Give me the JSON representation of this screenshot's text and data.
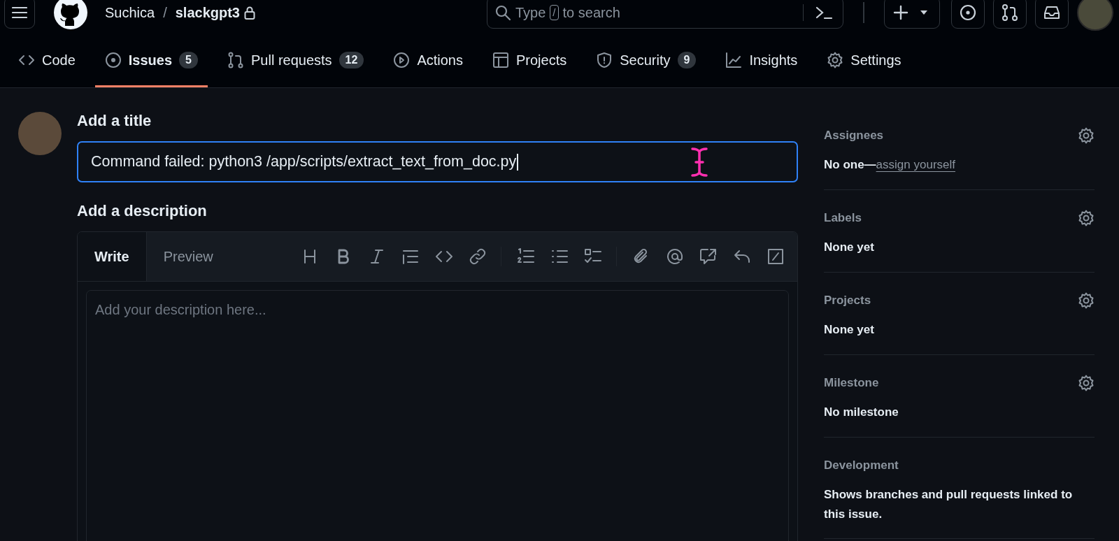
{
  "header": {
    "owner": "Suchica",
    "separator": "/",
    "repo": "slackgpt3",
    "private": true,
    "search": {
      "prefix": "Type",
      "key": "/",
      "suffix": "to search"
    }
  },
  "tabs": [
    {
      "kind": "code",
      "label": "Code",
      "selected": false
    },
    {
      "kind": "issue",
      "label": "Issues",
      "count": "5",
      "selected": true
    },
    {
      "kind": "pr",
      "label": "Pull requests",
      "count": "12",
      "selected": false
    },
    {
      "kind": "play",
      "label": "Actions",
      "selected": false
    },
    {
      "kind": "table",
      "label": "Projects",
      "selected": false
    },
    {
      "kind": "shield",
      "label": "Security",
      "count": "9",
      "selected": false
    },
    {
      "kind": "graph",
      "label": "Insights",
      "selected": false
    },
    {
      "kind": "gear",
      "label": "Settings",
      "selected": false
    }
  ],
  "form": {
    "title_label": "Add a title",
    "title_value": "Command failed: python3 /app/scripts/extract_text_from_doc.py",
    "description_label": "Add a description",
    "editor_tabs": [
      {
        "label": "Write",
        "selected": true
      },
      {
        "label": "Preview",
        "selected": false
      }
    ],
    "description_placeholder": "Add your description here..."
  },
  "sidebar": [
    {
      "heading": "Assignees",
      "gear": true,
      "value": "No one—",
      "link": "assign yourself"
    },
    {
      "heading": "Labels",
      "gear": true,
      "value": "None yet"
    },
    {
      "heading": "Projects",
      "gear": true,
      "value": "None yet"
    },
    {
      "heading": "Milestone",
      "gear": true,
      "value": "No milestone"
    },
    {
      "heading": "Development",
      "gear": false,
      "value": "Shows branches and pull requests linked to this issue."
    }
  ]
}
